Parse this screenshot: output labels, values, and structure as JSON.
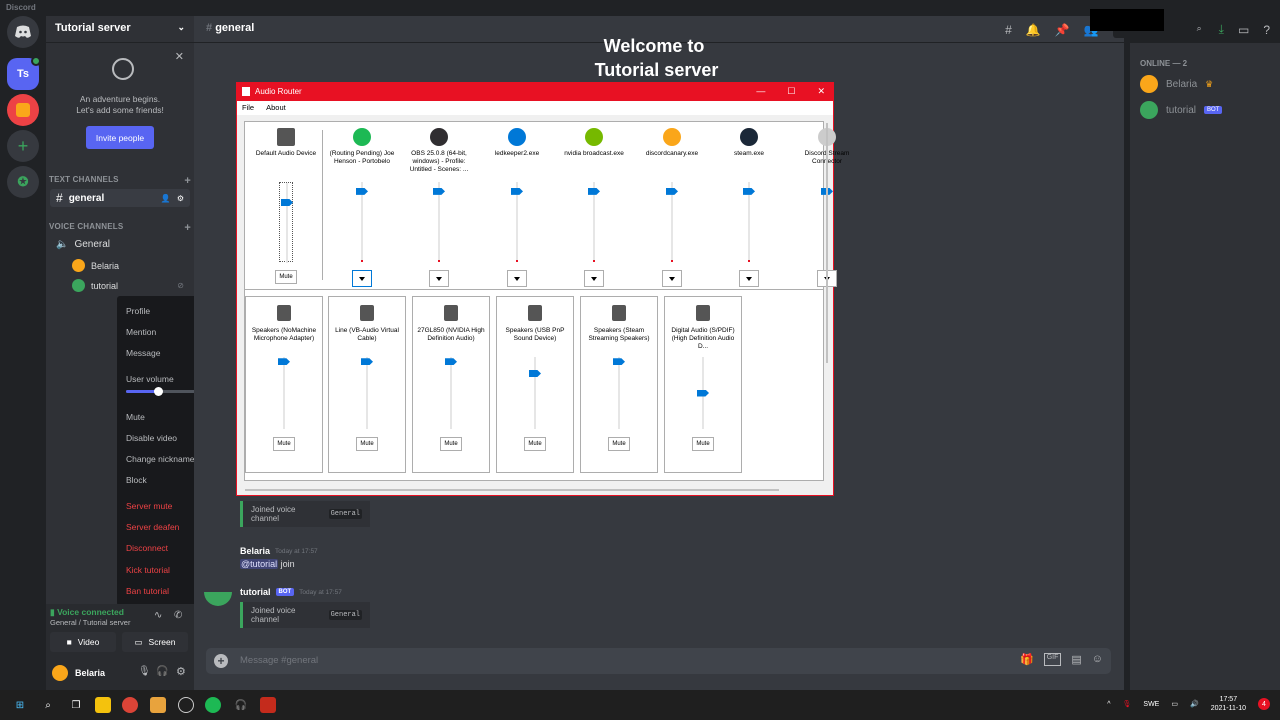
{
  "app": {
    "title": "Discord"
  },
  "server": {
    "name": "Tutorial server",
    "icon_initials": "Ts"
  },
  "invite": {
    "text": "An adventure begins.\nLet's add some friends!",
    "button": "Invite people"
  },
  "categories": {
    "text": "TEXT CHANNELS",
    "voice": "VOICE CHANNELS"
  },
  "channels": {
    "text": [
      {
        "name": "general"
      }
    ],
    "voice": [
      {
        "name": "General"
      }
    ]
  },
  "voice_users": [
    {
      "name": "Belaria"
    },
    {
      "name": "tutorial"
    }
  ],
  "context_menu": {
    "items": [
      "Profile",
      "Mention",
      "Message"
    ],
    "user_volume_label": "User volume",
    "user_volume_value": 0.33,
    "toggles": [
      "Mute",
      "Disable video"
    ],
    "items2": [
      "Change nickname",
      "Block"
    ],
    "server_toggles": [
      "Server mute",
      "Server deafen"
    ],
    "danger": [
      "Disconnect",
      "Kick tutorial",
      "Ban tutorial"
    ]
  },
  "voice_panel": {
    "status": "Voice connected",
    "location": "General / Tutorial server",
    "video": "Video",
    "screen": "Screen"
  },
  "user_bar": {
    "name": "Belaria"
  },
  "main": {
    "channel": "general",
    "welcome_line1": "Welcome to",
    "welcome_line2": "Tutorial server",
    "composer_placeholder": "Message #general"
  },
  "messages": [
    {
      "type": "join",
      "text": "Joined voice channel",
      "code": "General"
    },
    {
      "author": "Belaria",
      "time": "Today at 17:57",
      "mention": "@tutorial",
      "text": "join"
    },
    {
      "author": "tutorial",
      "badge": "BOT",
      "time": "Today at 17:57"
    },
    {
      "type": "join",
      "text": "Joined voice channel",
      "code": "General"
    }
  ],
  "members": {
    "category": "ONLINE — 2",
    "list": [
      {
        "name": "Belaria",
        "crown": "♛"
      },
      {
        "name": "tutorial",
        "badge": "BOT"
      }
    ]
  },
  "audio_router": {
    "title": "Audio Router",
    "menu": [
      "File",
      "About"
    ],
    "apps": [
      {
        "label": "Default Audio Device",
        "icon": "speaker",
        "color": "#555555",
        "level": 0.78
      },
      {
        "label": "(Routing Pending) Joe Henson - Portobelo",
        "icon": "spotify",
        "color": "#1db954",
        "level": 0.92
      },
      {
        "label": "OBS 25.0.8 (64-bit, windows) - Profile: Untitled - Scenes: ...",
        "icon": "obs",
        "color": "#302e31",
        "level": 0.92
      },
      {
        "label": "ledkeeper2.exe",
        "icon": "app",
        "color": "#0078d7",
        "level": 0.92
      },
      {
        "label": "nvidia broadcast.exe",
        "icon": "nvidia",
        "color": "#76b900",
        "level": 0.92
      },
      {
        "label": "discordcanary.exe",
        "icon": "discord",
        "color": "#faa61a",
        "level": 0.92
      },
      {
        "label": "steam.exe",
        "icon": "steam",
        "color": "#1b2838",
        "level": 0.92
      },
      {
        "label": "Discord Stream Connector",
        "icon": "app",
        "color": "#cccccc",
        "level": 0.92
      }
    ],
    "devices": [
      {
        "label": "Speakers (NoMachine Microphone Adapter)",
        "level": 0.98
      },
      {
        "label": "Line (VB-Audio Virtual Cable)",
        "level": 0.98
      },
      {
        "label": "27GL850 (NVIDIA High Definition Audio)",
        "level": 0.98
      },
      {
        "label": "Speakers (USB PnP Sound Device)",
        "level": 0.8
      },
      {
        "label": "Speakers (Steam Streaming Speakers)",
        "level": 0.98
      },
      {
        "label": "Digital Audio (S/PDIF) (High Definition Audio D...",
        "level": 0.5
      }
    ],
    "mute_label": "Mute"
  },
  "taskbar": {
    "language": "SWE",
    "time": "17:57",
    "date": "2021-11-10",
    "notifications": "4"
  }
}
